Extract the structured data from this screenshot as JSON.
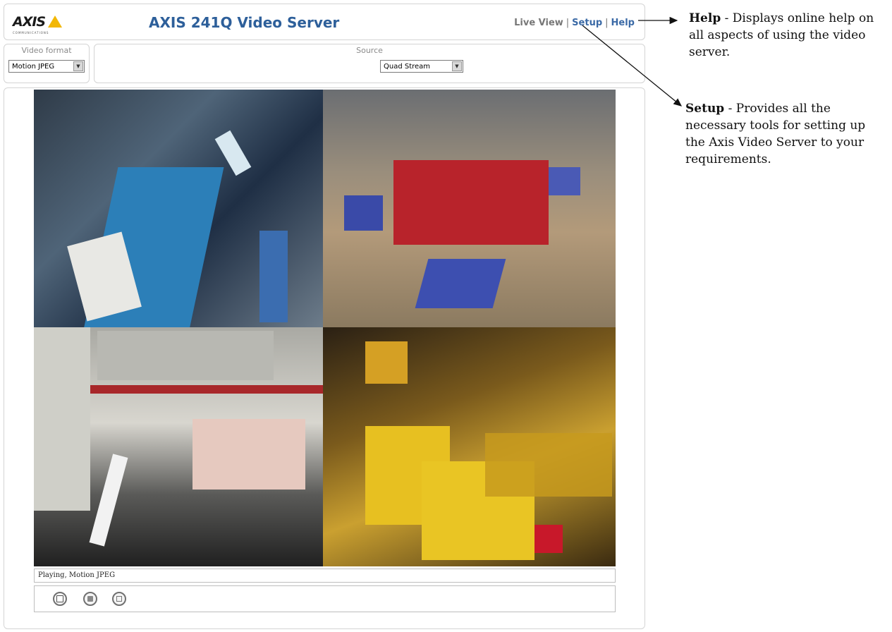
{
  "header": {
    "logo_text": "AXIS",
    "logo_tagline": "COMMUNICATIONS",
    "title": "AXIS 241Q Video Server",
    "nav": [
      {
        "label": "Live View"
      },
      {
        "label": "Setup"
      },
      {
        "label": "Help"
      }
    ],
    "nav_separator": "|"
  },
  "video_format": {
    "label": "Video format",
    "selected": "Motion JPEG"
  },
  "source": {
    "label": "Source",
    "selected": "Quad Stream"
  },
  "player": {
    "status": "Playing, Motion JPEG",
    "controls": [
      {
        "icon": "stop-icon"
      },
      {
        "icon": "snapshot-icon"
      },
      {
        "icon": "fullscreen-icon"
      }
    ]
  },
  "annotations": {
    "help": {
      "term": "Help",
      "text": " - Displays online help on all aspects of using the video server."
    },
    "setup": {
      "term": "Setup",
      "text": " - Provides all the necessary tools for setting up the Axis Video Server to your requirements."
    }
  },
  "colors": {
    "brand_title": "#2d5f9a",
    "nav_link": "#3b6aa6",
    "logo_triangle": "#f2b705"
  }
}
